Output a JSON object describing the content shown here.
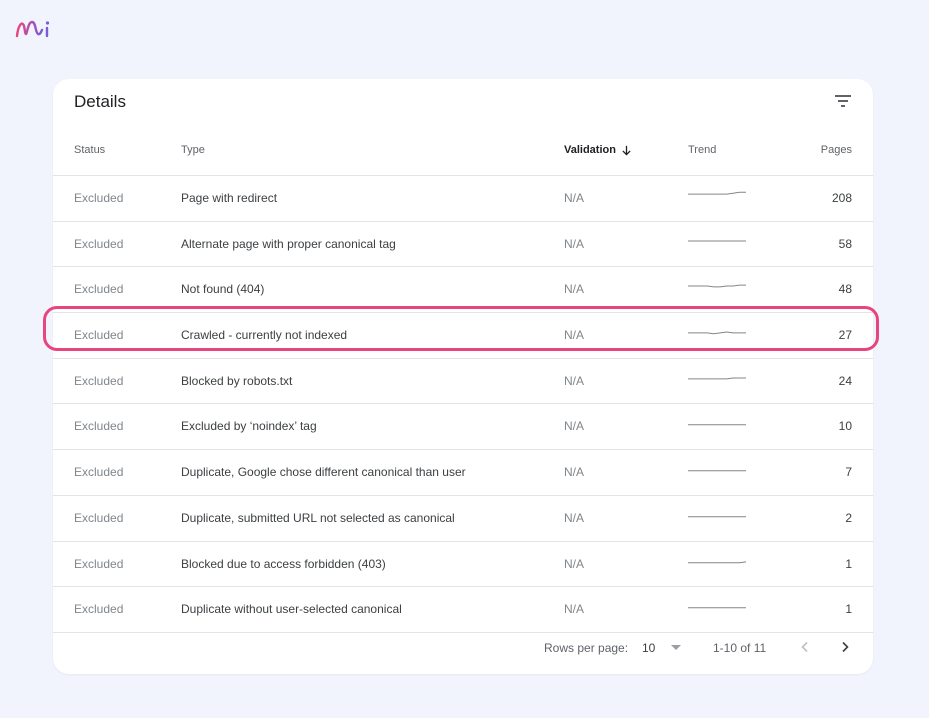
{
  "card": {
    "title": "Details"
  },
  "table": {
    "headers": {
      "status": "Status",
      "type": "Type",
      "validation": "Validation",
      "trend": "Trend",
      "pages": "Pages"
    },
    "rows": [
      {
        "status": "Excluded",
        "type": "Page with redirect",
        "validation": "N/A",
        "pages": "208",
        "trend": [
          0.45,
          0.45,
          0.45,
          0.45,
          0.45,
          0.45,
          0.45,
          0.4,
          0.35,
          0.35
        ]
      },
      {
        "status": "Excluded",
        "type": "Alternate page with proper canonical tag",
        "validation": "N/A",
        "pages": "58",
        "trend": [
          0.5,
          0.5,
          0.5,
          0.5,
          0.5,
          0.5,
          0.5,
          0.5,
          0.5,
          0.5
        ]
      },
      {
        "status": "Excluded",
        "type": "Not found (404)",
        "validation": "N/A",
        "pages": "48",
        "trend": [
          0.5,
          0.5,
          0.5,
          0.5,
          0.55,
          0.55,
          0.5,
          0.5,
          0.45,
          0.45
        ]
      },
      {
        "status": "Excluded",
        "type": "Crawled - currently not indexed",
        "validation": "N/A",
        "pages": "27",
        "trend": [
          0.55,
          0.55,
          0.55,
          0.55,
          0.6,
          0.55,
          0.5,
          0.55,
          0.55,
          0.55
        ]
      },
      {
        "status": "Excluded",
        "type": "Blocked by robots.txt",
        "validation": "N/A",
        "pages": "24",
        "trend": [
          0.55,
          0.55,
          0.55,
          0.55,
          0.55,
          0.55,
          0.55,
          0.5,
          0.5,
          0.5
        ]
      },
      {
        "status": "Excluded",
        "type": "Excluded by ‘noindex’ tag",
        "validation": "N/A",
        "pages": "10",
        "trend": [
          0.6,
          0.6,
          0.6,
          0.6,
          0.6,
          0.6,
          0.6,
          0.6,
          0.6,
          0.6
        ]
      },
      {
        "status": "Excluded",
        "type": "Duplicate, Google chose different canonical than user",
        "validation": "N/A",
        "pages": "7",
        "trend": [
          0.6,
          0.6,
          0.6,
          0.6,
          0.6,
          0.6,
          0.6,
          0.6,
          0.6,
          0.6
        ]
      },
      {
        "status": "Excluded",
        "type": "Duplicate, submitted URL not selected as canonical",
        "validation": "N/A",
        "pages": "2",
        "trend": [
          0.6,
          0.6,
          0.6,
          0.6,
          0.6,
          0.6,
          0.6,
          0.6,
          0.6,
          0.6
        ]
      },
      {
        "status": "Excluded",
        "type": "Blocked due to access forbidden (403)",
        "validation": "N/A",
        "pages": "1",
        "trend": [
          0.6,
          0.6,
          0.6,
          0.6,
          0.6,
          0.6,
          0.6,
          0.6,
          0.6,
          0.55
        ]
      },
      {
        "status": "Excluded",
        "type": "Duplicate without user-selected canonical",
        "validation": "N/A",
        "pages": "1",
        "trend": [
          0.6,
          0.6,
          0.6,
          0.6,
          0.6,
          0.6,
          0.6,
          0.6,
          0.6,
          0.6
        ]
      }
    ],
    "highlighted_row": 3
  },
  "pagination": {
    "rows_per_page_label": "Rows per page:",
    "rows_per_page_value": "10",
    "range_label": "1-10 of 11"
  },
  "colors": {
    "highlight": "#e8457e",
    "logo_purple": "#7b5bd6",
    "logo_pink": "#e8457e"
  },
  "icons": {
    "logo": "brand-logo-icon",
    "filter": "filter-icon",
    "sort": "arrow-down-icon",
    "dropdown": "caret-down-icon",
    "prev": "chevron-left-icon",
    "next": "chevron-right-icon"
  }
}
